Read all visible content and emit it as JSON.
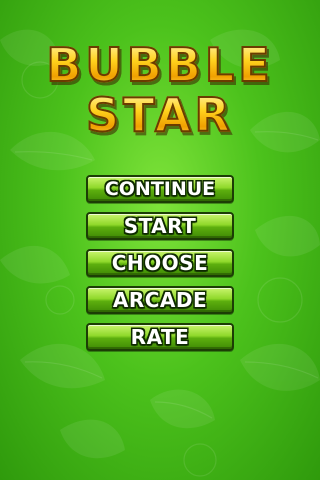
{
  "title": {
    "line1": "BUBBLE",
    "line2": "STAR"
  },
  "menu": {
    "items": [
      {
        "label": "CONTINUE"
      },
      {
        "label": "START"
      },
      {
        "label": "CHOOSE"
      },
      {
        "label": "ARCADE"
      },
      {
        "label": "RATE"
      }
    ]
  },
  "colors": {
    "background": "#4cc21c",
    "title_gold": "#ffd21e",
    "title_outline": "#6a3c00",
    "button_green": "#8fd82a",
    "button_border": "#1c3d05"
  }
}
